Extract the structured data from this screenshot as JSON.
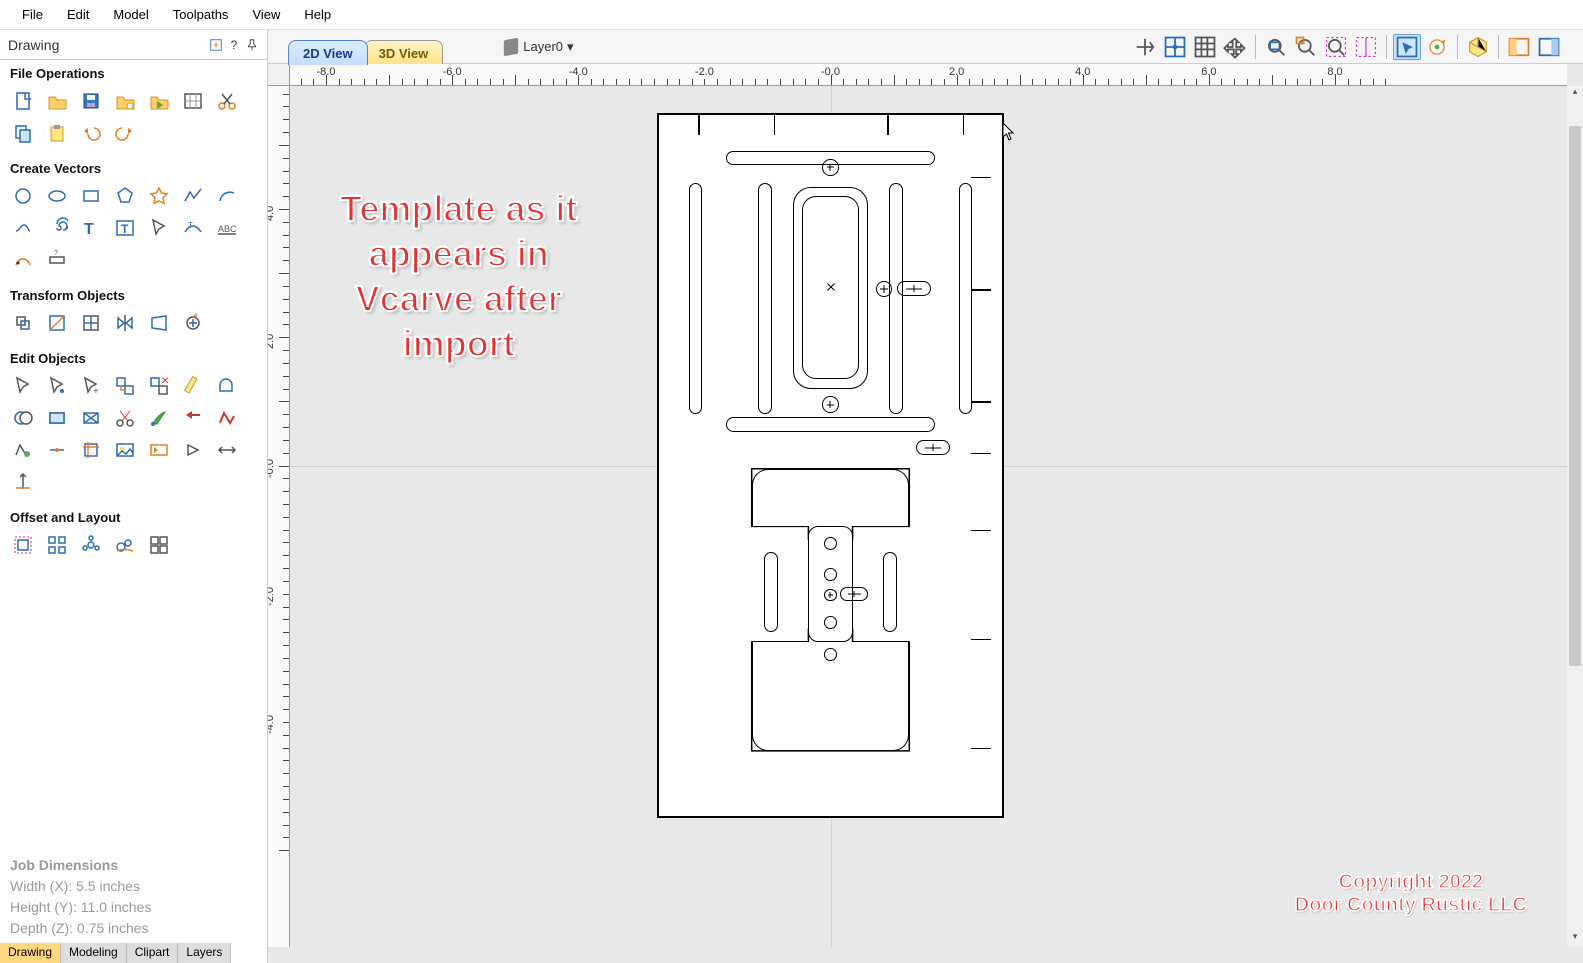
{
  "menu": {
    "items": [
      "File",
      "Edit",
      "Model",
      "Toolpaths",
      "View",
      "Help"
    ]
  },
  "panel": {
    "title": "Drawing",
    "controls": {
      "switch": "↕",
      "help": "?",
      "pin": "📌"
    },
    "sections": {
      "file_ops": "File Operations",
      "create_vectors": "Create Vectors",
      "transform": "Transform Objects",
      "edit": "Edit Objects",
      "offset": "Offset and Layout"
    },
    "bottom_tabs": [
      "Drawing",
      "Modeling",
      "Clipart",
      "Layers"
    ]
  },
  "job_dimensions": {
    "title": "Job Dimensions",
    "width": "Width  (X): 5.5 inches",
    "height": "Height (Y): 11.0 inches",
    "depth": "Depth  (Z): 0.75 inches"
  },
  "canvas": {
    "tabs": {
      "view2d": "2D View",
      "view3d": "3D View"
    },
    "layer": "Layer0",
    "ruler_h": [
      "-8.0",
      "-6.0",
      "-4.0",
      "-2.0",
      "-0.0",
      "2.0",
      "4.0",
      "6.0",
      "8.0"
    ],
    "ruler_v": [
      "4.0",
      "2.0",
      "-0.0",
      "-2.0",
      "-4.0"
    ]
  },
  "overlay": {
    "line1": "Template as it",
    "line2": "appears in",
    "line3": "Vcarve after",
    "line4": "import"
  },
  "copyright": {
    "line1": "Copyright 2022",
    "line2": "Door County Rustic LLC"
  },
  "icons": {
    "file_ops": [
      "new-file",
      "open-folder",
      "save-disk",
      "open-recent",
      "play-file",
      "import",
      "cut",
      "copy",
      "paste",
      "undo",
      "redo"
    ],
    "create": [
      "circle",
      "ellipse",
      "rectangle",
      "polygon",
      "star",
      "polyline",
      "arc",
      "s-curve",
      "spiral",
      "text",
      "text-box",
      "pick",
      "text-on-curve",
      "abc",
      "trace",
      "dimension"
    ],
    "transform": [
      "move",
      "scale",
      "center",
      "mirror",
      "distort",
      "rotate"
    ],
    "edit": [
      "select",
      "node-edit",
      "node-add",
      "group",
      "ungroup",
      "measure",
      "bool-union",
      "bool-sub",
      "bool-int",
      "bool-xor",
      "scissors",
      "brush",
      "reverse",
      "smooth",
      "close",
      "join",
      "crop",
      "image",
      "offset-in",
      "offset-out",
      "offset-both",
      "offset-last"
    ],
    "offset": [
      "offset",
      "array",
      "circular",
      "nest",
      "plate"
    ],
    "canvas_right": [
      "toggle-origin",
      "snap-grid",
      "show-grid",
      "pan",
      "zoom-fit",
      "zoom-window",
      "zoom-sel",
      "guides",
      "select-mode",
      "rotate-view",
      "3d-view",
      "layout-1",
      "layout-2"
    ]
  }
}
